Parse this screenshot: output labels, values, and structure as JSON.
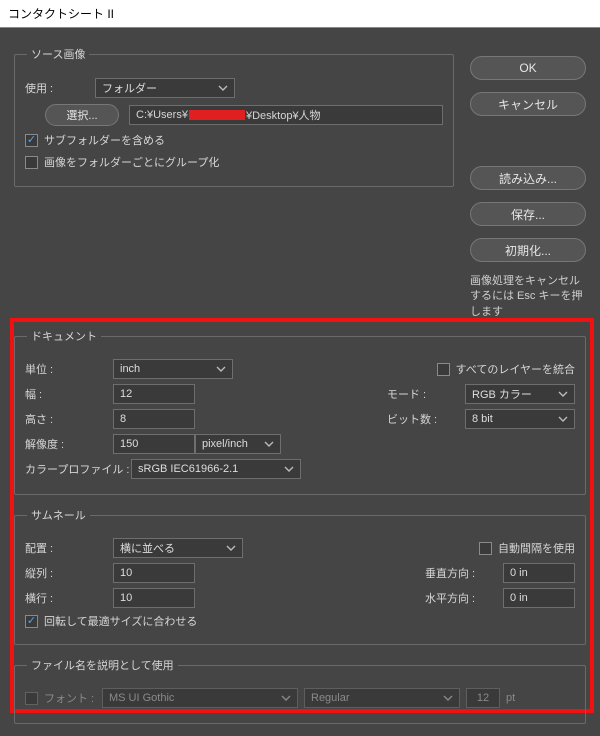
{
  "window": {
    "title": "コンタクトシート II"
  },
  "buttons": {
    "ok": "OK",
    "cancel": "キャンセル",
    "load": "読み込み...",
    "save": "保存...",
    "reset": "初期化...",
    "select": "選択..."
  },
  "hint": "画像処理をキャンセルするには Esc キーを押します",
  "source": {
    "legend": "ソース画像",
    "use_label": "使用 :",
    "use_value": "フォルダー",
    "path_prefix": "C:¥Users¥",
    "path_suffix": "¥Desktop¥人物",
    "subfolders": "サブフォルダーを含める",
    "group_by_folder": "画像をフォルダーごとにグループ化"
  },
  "doc": {
    "legend": "ドキュメント",
    "unit_label": "単位 :",
    "unit_value": "inch",
    "flatten": "すべてのレイヤーを統合",
    "width_label": "幅 :",
    "width_value": "12",
    "mode_label": "モード :",
    "mode_value": "RGB カラー",
    "height_label": "高さ :",
    "height_value": "8",
    "bit_label": "ビット数 :",
    "bit_value": "8 bit",
    "res_label": "解像度 :",
    "res_value": "150",
    "res_unit": "pixel/inch",
    "profile_label": "カラープロファイル :",
    "profile_value": "sRGB IEC61966-2.1"
  },
  "thumb": {
    "legend": "サムネール",
    "place_label": "配置 :",
    "place_value": "横に並べる",
    "auto_spacing": "自動間隔を使用",
    "cols_label": "縦列 :",
    "cols_value": "10",
    "vspace_label": "垂直方向 :",
    "vspace_value": "0 in",
    "rows_label": "横行 :",
    "rows_value": "10",
    "hspace_label": "水平方向 :",
    "hspace_value": "0 in",
    "rotate": "回転して最適サイズに合わせる"
  },
  "caption": {
    "legend": "ファイル名を説明として使用",
    "font_label": "フォント :",
    "font_value": "MS UI Gothic",
    "style_value": "Regular",
    "size_value": "12",
    "size_unit": "pt"
  }
}
